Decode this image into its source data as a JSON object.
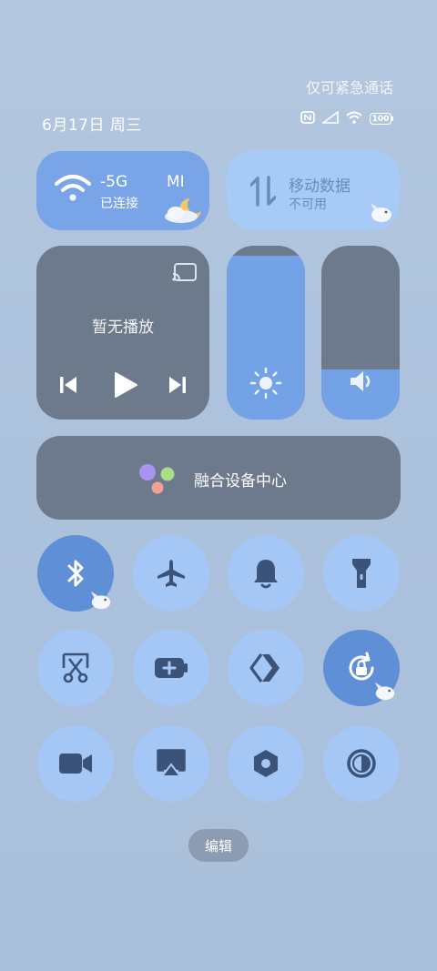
{
  "status": {
    "emergency_text": "仅可紧急通话",
    "date": "6月17日 周三",
    "battery": "100"
  },
  "tiles": {
    "wifi": {
      "name": "-5G",
      "state": "已连接",
      "extra": "MI"
    },
    "mobile_data": {
      "name": "移动数据",
      "state": "不可用"
    },
    "media": {
      "label": "暂无播放"
    },
    "brightness_level": 0.94,
    "volume_level": 0.29,
    "hub": {
      "label": "融合设备中心"
    }
  },
  "toggles": [
    {
      "name": "bluetooth",
      "on": true
    },
    {
      "name": "airplane",
      "on": false
    },
    {
      "name": "bell",
      "on": false
    },
    {
      "name": "flashlight",
      "on": false
    },
    {
      "name": "screenshot",
      "on": false
    },
    {
      "name": "battery-saver",
      "on": false
    },
    {
      "name": "cast",
      "on": false
    },
    {
      "name": "rotation-lock",
      "on": true
    },
    {
      "name": "screen-record",
      "on": false
    },
    {
      "name": "screen-mirror",
      "on": false
    },
    {
      "name": "settings",
      "on": false
    },
    {
      "name": "dark-mode",
      "on": false
    }
  ],
  "edit_label": "编辑",
  "colors": {
    "tile_active": "#79a5e8",
    "tile_dark": "#6c7a8b",
    "button_off": "#a4c7f6",
    "button_on": "#5f8fd6",
    "icon_dark": "#3b5378"
  }
}
